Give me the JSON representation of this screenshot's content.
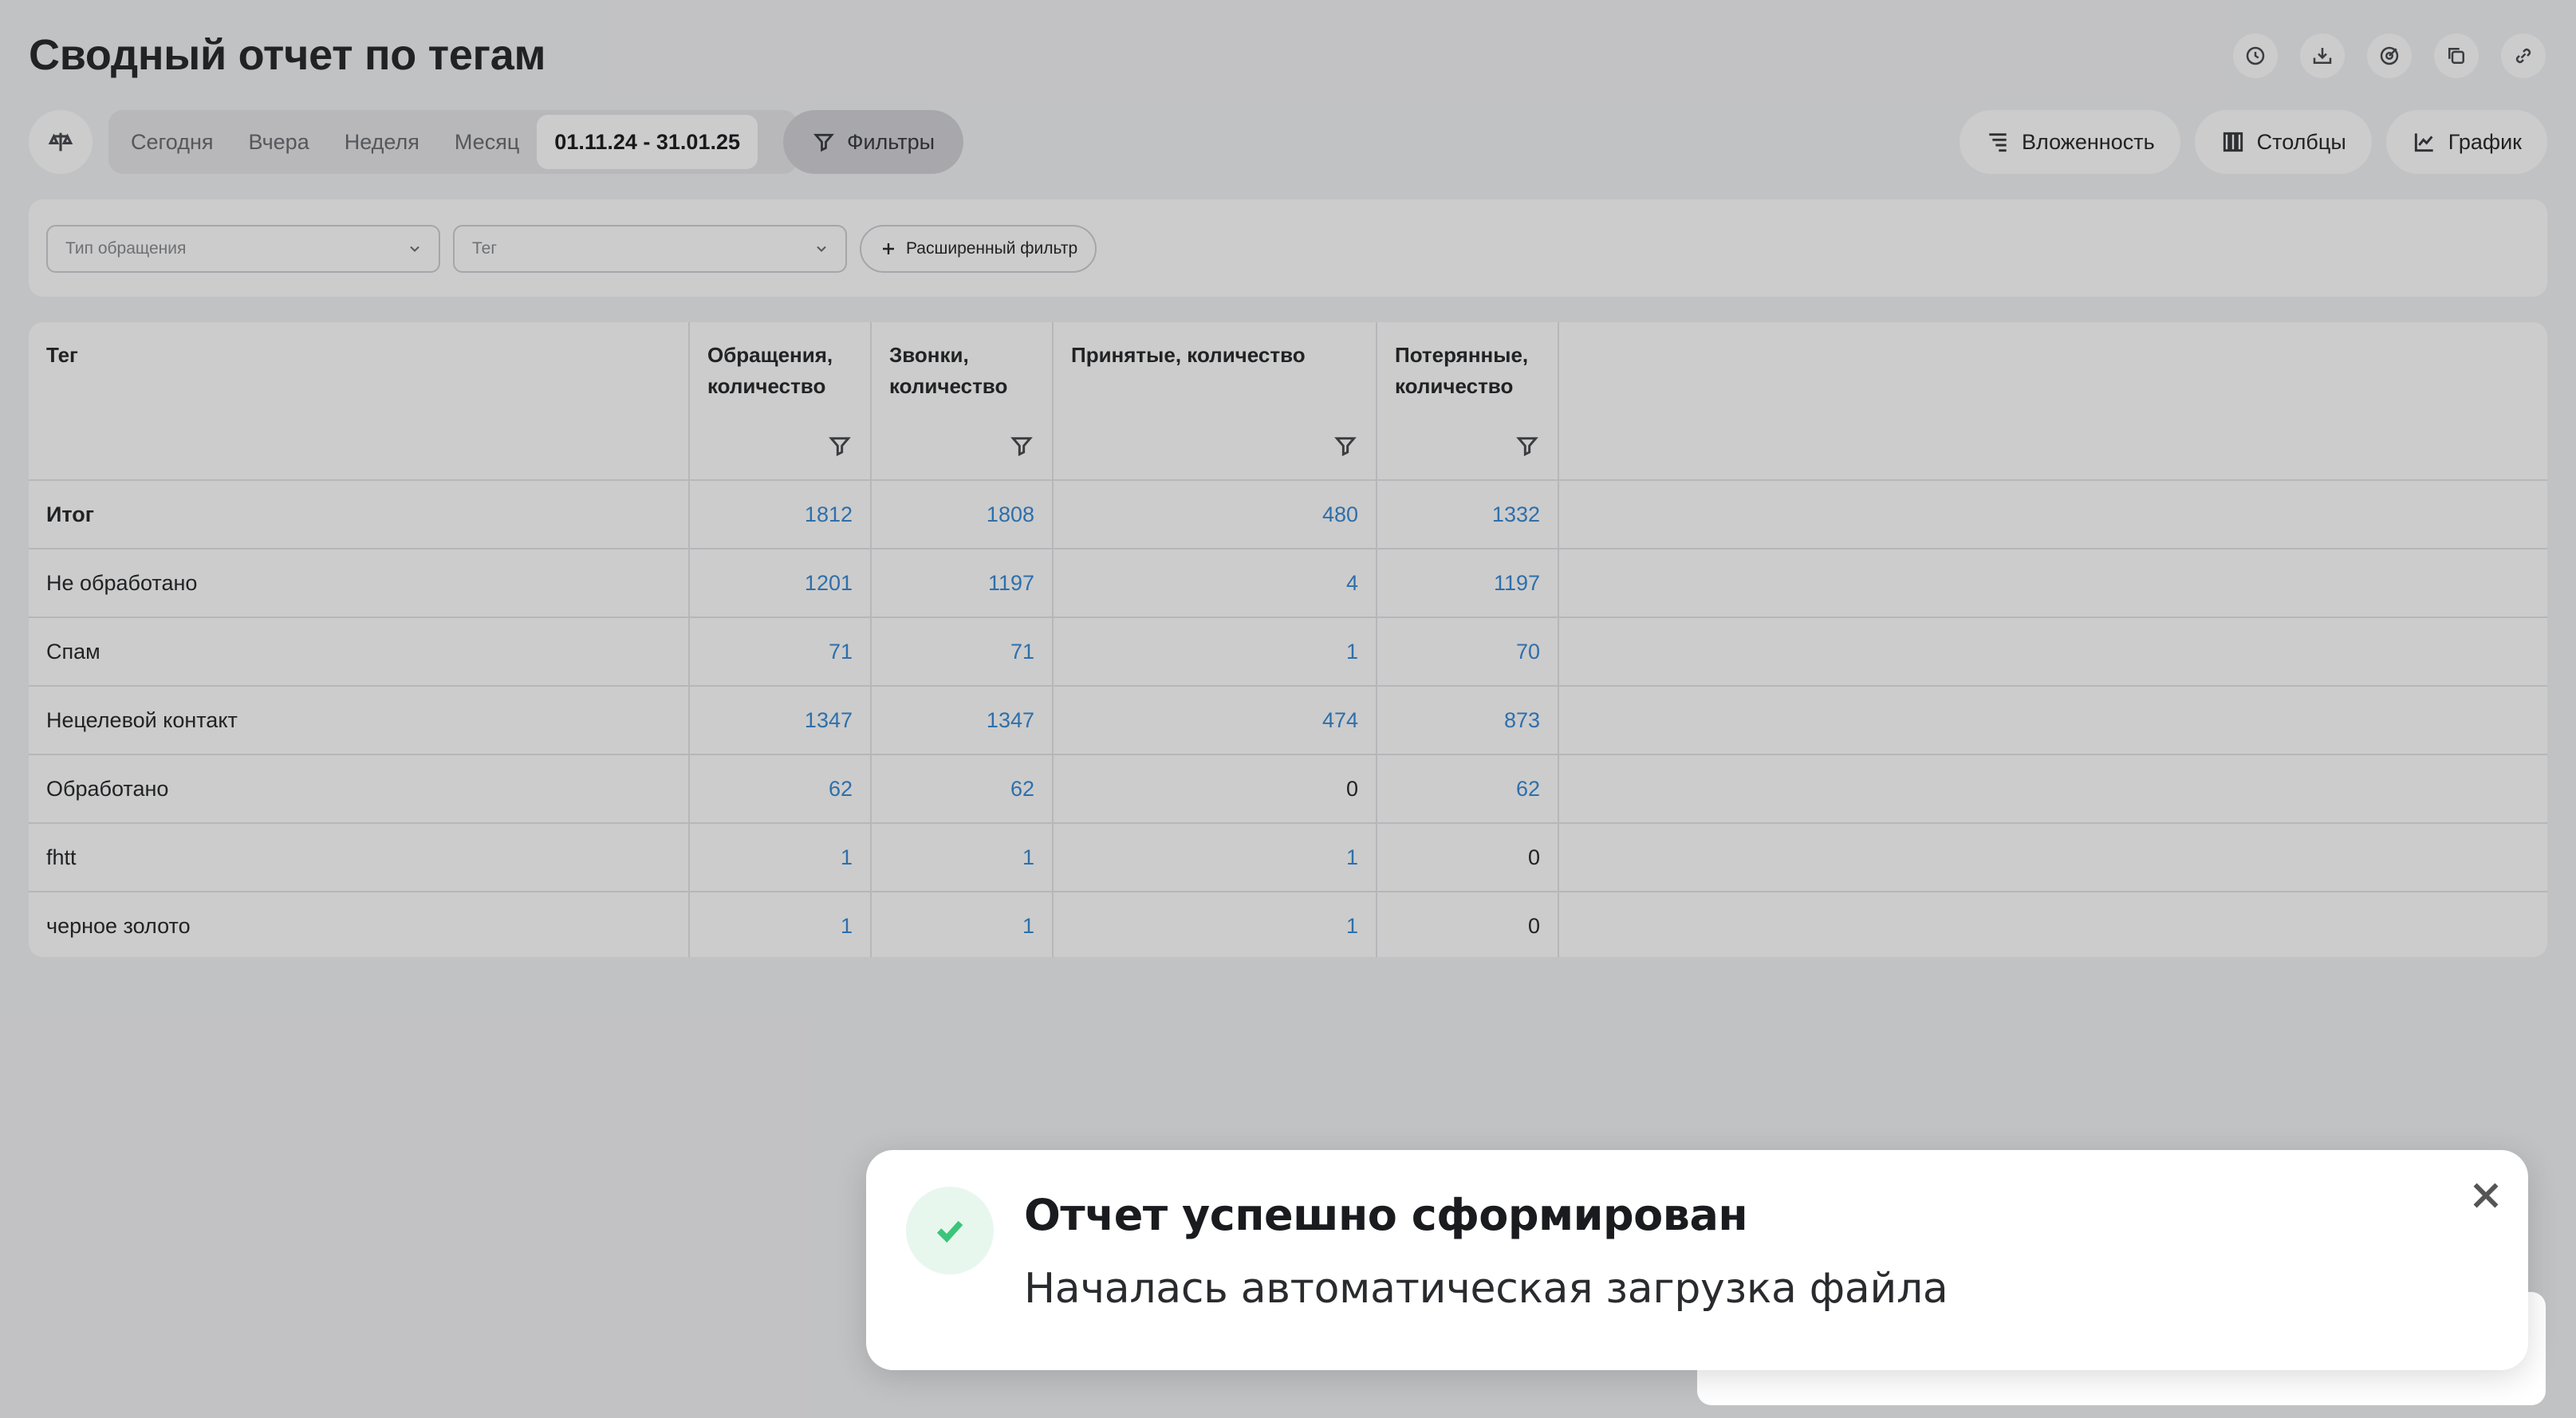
{
  "page": {
    "title": "Сводный отчет по тегам"
  },
  "top_actions": [
    {
      "name": "history-icon"
    },
    {
      "name": "download-icon"
    },
    {
      "name": "target-icon"
    },
    {
      "name": "copy-icon"
    },
    {
      "name": "link-icon"
    }
  ],
  "toolbar": {
    "periods": [
      {
        "label": "Сегодня",
        "active": false
      },
      {
        "label": "Вчера",
        "active": false
      },
      {
        "label": "Неделя",
        "active": false
      },
      {
        "label": "Месяц",
        "active": false
      },
      {
        "label": "01.11.24 - 31.01.25",
        "active": true
      }
    ],
    "filters_label": "Фильтры",
    "nesting_label": "Вложенность",
    "columns_label": "Столбцы",
    "chart_label": "График"
  },
  "filters": {
    "type_placeholder": "Тип обращения",
    "tag_placeholder": "Тег",
    "advanced_label": "Расширенный фильтр"
  },
  "table": {
    "columns": [
      "Тег",
      "Обращения, количество",
      "Звонки, количество",
      "Принятые, количество",
      "Потерянные, количество"
    ],
    "rows": [
      {
        "tag": "Итог",
        "requests": "1812",
        "calls": "1808",
        "accepted": "480",
        "lost": "1332"
      },
      {
        "tag": "Не обработано",
        "requests": "1201",
        "calls": "1197",
        "accepted": "4",
        "lost": "1197"
      },
      {
        "tag": "Спам",
        "requests": "71",
        "calls": "71",
        "accepted": "1",
        "lost": "70"
      },
      {
        "tag": "Нецелевой контакт",
        "requests": "1347",
        "calls": "1347",
        "accepted": "474",
        "lost": "873"
      },
      {
        "tag": "Обработано",
        "requests": "62",
        "calls": "62",
        "accepted": "0",
        "lost": "62"
      },
      {
        "tag": "fhtt",
        "requests": "1",
        "calls": "1",
        "accepted": "1",
        "lost": "0"
      },
      {
        "tag": "черное золото",
        "requests": "1",
        "calls": "1",
        "accepted": "1",
        "lost": "0"
      }
    ]
  },
  "toast": {
    "title": "Отчет успешно сформирован",
    "message": "Началась автоматическая загрузка файла"
  },
  "colors": {
    "link": "#3a8bd6",
    "success": "#3bc57a"
  }
}
